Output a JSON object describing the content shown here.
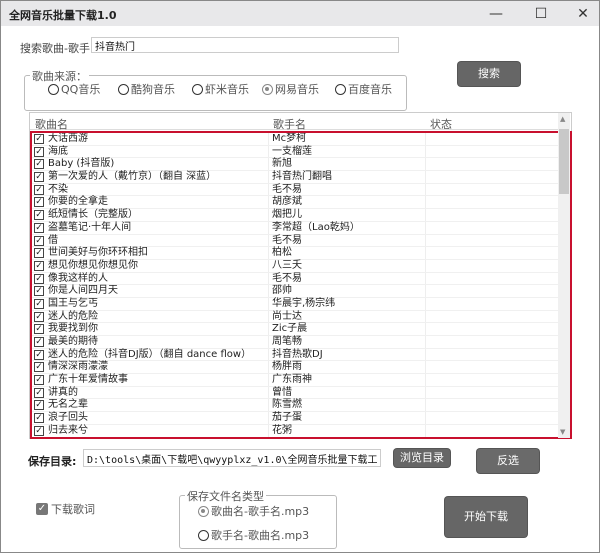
{
  "window": {
    "title": "全网音乐批量下载1.0",
    "minimize": "—",
    "maximize": "☐",
    "close": "✕"
  },
  "search": {
    "label": "搜索歌曲-歌手",
    "value": "抖音热门",
    "button": "搜索"
  },
  "source": {
    "label": "歌曲来源：",
    "options": [
      {
        "label": "QQ音乐",
        "selected": false
      },
      {
        "label": "酷狗音乐",
        "selected": false
      },
      {
        "label": "虾米音乐",
        "selected": false
      },
      {
        "label": "网易音乐",
        "selected": true
      },
      {
        "label": "百度音乐",
        "selected": false
      }
    ]
  },
  "table": {
    "headers": [
      "歌曲名",
      "歌手名",
      "状态"
    ],
    "rows": [
      {
        "name": "大话西游",
        "artist": "Mc梦柯",
        "checked": true
      },
      {
        "name": "海底",
        "artist": "一支榴莲",
        "checked": true
      },
      {
        "name": "Baby (抖音版)",
        "artist": "新旭",
        "checked": true
      },
      {
        "name": "第一次爱的人（戴竹京）（翻自 深蓝）",
        "artist": "抖音热门翻唱",
        "checked": true
      },
      {
        "name": "不染",
        "artist": "毛不易",
        "checked": true
      },
      {
        "name": "你要的全拿走",
        "artist": "胡彦斌",
        "checked": true
      },
      {
        "name": "纸短情长（完整版）",
        "artist": "烟把儿",
        "checked": true
      },
      {
        "name": "盗墓笔记·十年人间",
        "artist": "李常超（Lao乾妈）",
        "checked": true
      },
      {
        "name": "借",
        "artist": "毛不易",
        "checked": true
      },
      {
        "name": "世间美好与你环环相扣",
        "artist": "柏松",
        "checked": true
      },
      {
        "name": "想见你想见你想见你",
        "artist": "八三夭",
        "checked": true
      },
      {
        "name": "像我这样的人",
        "artist": "毛不易",
        "checked": true
      },
      {
        "name": "你是人间四月天",
        "artist": "邵帅",
        "checked": true
      },
      {
        "name": "国王与乞丐",
        "artist": "华晨宇,杨宗纬",
        "checked": true
      },
      {
        "name": "迷人的危险",
        "artist": "尚士达",
        "checked": true
      },
      {
        "name": "我要找到你",
        "artist": "Zic子晨",
        "checked": true
      },
      {
        "name": "最美的期待",
        "artist": "周笔畅",
        "checked": true
      },
      {
        "name": "迷人的危险（抖音DJ版）（翻自 dance flow）",
        "artist": "抖音热歌DJ",
        "checked": true
      },
      {
        "name": "情深深雨濛濛",
        "artist": "杨胖雨",
        "checked": true
      },
      {
        "name": "广东十年爱情故事",
        "artist": "广东雨神",
        "checked": true
      },
      {
        "name": "讲真的",
        "artist": "曾惜",
        "checked": true
      },
      {
        "name": "无名之辈",
        "artist": "陈雪燃",
        "checked": true
      },
      {
        "name": "浪子回头",
        "artist": "茄子蛋",
        "checked": true
      },
      {
        "name": "归去来兮",
        "artist": "花粥",
        "checked": true
      }
    ]
  },
  "save": {
    "label": "保存目录:",
    "path": "D:\\tools\\桌面\\下载吧\\qwyyplxz_v1.0\\全网音乐批量下载工具\\下载文",
    "browse": "浏览目录",
    "invert": "反选"
  },
  "lyrics": {
    "label": "下载歌词",
    "checked": true
  },
  "filename": {
    "label": "保存文件名类型",
    "options": [
      {
        "label": "歌曲名-歌手名.mp3",
        "selected": true
      },
      {
        "label": "歌手名-歌曲名.mp3",
        "selected": false
      }
    ]
  },
  "download": {
    "label": "开始下载"
  },
  "colors": {
    "highlight": "#c8102e",
    "button": "#666666"
  }
}
